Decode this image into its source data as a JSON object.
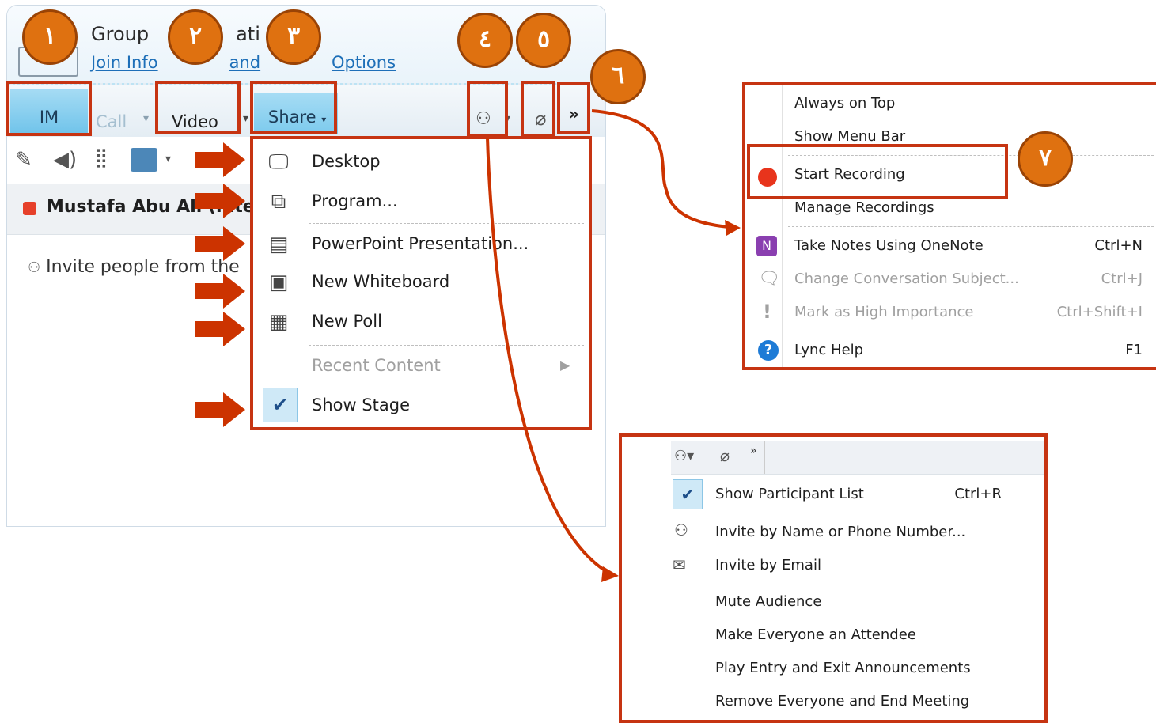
{
  "window": {
    "title": "Group",
    "title_frag": "ati",
    "join_link": "Join Info",
    "join_link_frag": "and",
    "options_link": "Options",
    "tabs": {
      "im": "IM",
      "call": "Call",
      "video": "Video",
      "share": "Share"
    },
    "participant_name": "Mustafa Abu Ali",
    "participant_name_frag": "(inte",
    "invite_text": "Invite people from the"
  },
  "share_menu": {
    "items": [
      {
        "label": "Desktop",
        "icon": "monitor-icon"
      },
      {
        "label": "Program...",
        "icon": "program-icon"
      },
      {
        "label": "PowerPoint Presentation...",
        "icon": "presentation-icon"
      },
      {
        "label": "New Whiteboard",
        "icon": "whiteboard-icon"
      },
      {
        "label": "New Poll",
        "icon": "poll-icon"
      },
      {
        "label": "Recent Content",
        "icon": "",
        "disabled": true
      },
      {
        "label": "Show Stage",
        "icon": "checkmark-icon",
        "checked": true
      }
    ]
  },
  "more_menu": {
    "items": [
      {
        "label": "Always on Top",
        "shortcut": ""
      },
      {
        "label": "Show Menu Bar",
        "shortcut": ""
      },
      {
        "label": "Start Recording",
        "shortcut": ""
      },
      {
        "label": "Manage Recordings",
        "shortcut": ""
      },
      {
        "label": "Take Notes Using OneNote",
        "shortcut": "Ctrl+N"
      },
      {
        "label": "Change Conversation Subject...",
        "shortcut": "Ctrl+J",
        "disabled": true
      },
      {
        "label": "Mark as High Importance",
        "shortcut": "Ctrl+Shift+I",
        "disabled": true
      },
      {
        "label": "Lync Help",
        "shortcut": "F1"
      }
    ]
  },
  "participants_menu": {
    "toolbar_more": "»",
    "items": [
      {
        "label": "Show Participant List",
        "shortcut": "Ctrl+R",
        "checked": true
      },
      {
        "label": "Invite by Name or Phone Number...",
        "shortcut": ""
      },
      {
        "label": "Invite by Email",
        "shortcut": ""
      },
      {
        "label": "Mute Audience",
        "shortcut": ""
      },
      {
        "label": "Make Everyone an Attendee",
        "shortcut": ""
      },
      {
        "label": "Play Entry and Exit Announcements",
        "shortcut": ""
      },
      {
        "label": "Remove Everyone and End Meeting",
        "shortcut": ""
      }
    ]
  },
  "more_button": "»",
  "callouts": [
    "١",
    "٢",
    "٣",
    "٤",
    "٥",
    "٦",
    "٧"
  ],
  "colors": {
    "callout": "#df7110",
    "highlight": "#c63412",
    "arrow": "#cc3300",
    "im_tab": "#6fc3ea"
  }
}
